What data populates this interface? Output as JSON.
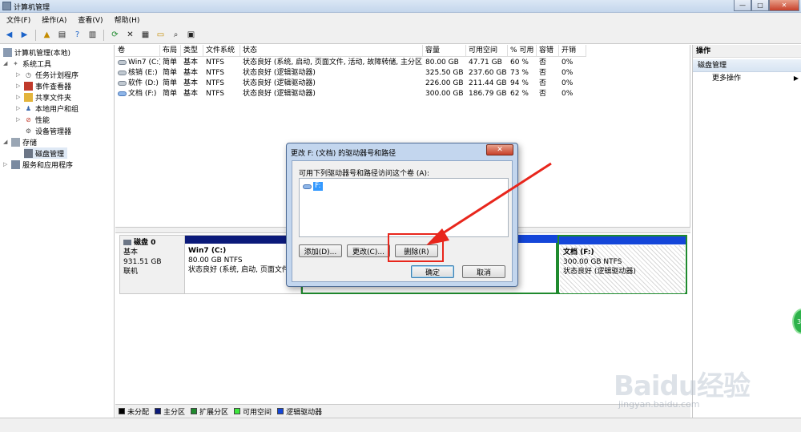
{
  "window": {
    "title": "计算机管理",
    "min": "—",
    "max": "□",
    "close": "✕"
  },
  "menu": [
    "文件(F)",
    "操作(A)",
    "查看(V)",
    "帮助(H)"
  ],
  "tree": {
    "root": "计算机管理(本地)",
    "system_tools": "系统工具",
    "task_scheduler": "任务计划程序",
    "event_viewer": "事件查看器",
    "shared_folders": "共享文件夹",
    "local_users": "本地用户和组",
    "performance": "性能",
    "device_manager": "设备管理器",
    "storage": "存储",
    "disk_management": "磁盘管理",
    "services": "服务和应用程序"
  },
  "columns": [
    "卷",
    "布局",
    "类型",
    "文件系统",
    "状态",
    "容量",
    "可用空间",
    "% 可用",
    "容错",
    "开销"
  ],
  "volumes": [
    {
      "name": "Win7 (C:)",
      "layout": "简单",
      "type": "基本",
      "fs": "NTFS",
      "status": "状态良好 (系统, 启动, 页面文件, 活动, 故障转储, 主分区)",
      "capacity": "80.00 GB",
      "free": "47.71 GB",
      "pct": "60 %",
      "fault": "否",
      "overhead": "0%"
    },
    {
      "name": "核销 (E:)",
      "layout": "简单",
      "type": "基本",
      "fs": "NTFS",
      "status": "状态良好 (逻辑驱动器)",
      "capacity": "325.50 GB",
      "free": "237.60 GB",
      "pct": "73 %",
      "fault": "否",
      "overhead": "0%"
    },
    {
      "name": "软件 (D:)",
      "layout": "简单",
      "type": "基本",
      "fs": "NTFS",
      "status": "状态良好 (逻辑驱动器)",
      "capacity": "226.00 GB",
      "free": "211.44 GB",
      "pct": "94 %",
      "fault": "否",
      "overhead": "0%"
    },
    {
      "name": "文档 (F:)",
      "layout": "简单",
      "type": "基本",
      "fs": "NTFS",
      "status": "状态良好 (逻辑驱动器)",
      "capacity": "300.00 GB",
      "free": "186.79 GB",
      "pct": "62 %",
      "fault": "否",
      "overhead": "0%"
    }
  ],
  "disk": {
    "name": "磁盘 0",
    "type": "基本",
    "size": "931.51 GB",
    "state": "联机"
  },
  "partitions": {
    "c": {
      "name": "Win7  (C:)",
      "size": "80.00 GB NTFS",
      "status": "状态良好 (系统, 启动, 页面文件"
    },
    "f": {
      "name": "文档  (F:)",
      "size": "300.00 GB NTFS",
      "status": "状态良好 (逻辑驱动器)"
    }
  },
  "legend": [
    {
      "label": "未分配",
      "color": "#000000"
    },
    {
      "label": "主分区",
      "color": "#0b1a7a"
    },
    {
      "label": "扩展分区",
      "color": "#1f8a2e"
    },
    {
      "label": "可用空间",
      "color": "#3ee83e"
    },
    {
      "label": "逻辑驱动器",
      "color": "#1446d9"
    }
  ],
  "ops": {
    "header": "操作",
    "section": "磁盘管理",
    "more": "更多操作"
  },
  "dialog": {
    "title": "更改 F: (文档) 的驱动器号和路径",
    "label": "可用下列驱动器号和路径访问这个卷 (A):",
    "item": "F:",
    "add": "添加(D)...",
    "change": "更改(C)...",
    "delete": "删除(R)",
    "ok": "确定",
    "cancel": "取消",
    "close": "✕"
  },
  "watermark": {
    "brand": "Baidu经验",
    "url": "jingyan.baidu.com"
  },
  "badge": "3"
}
